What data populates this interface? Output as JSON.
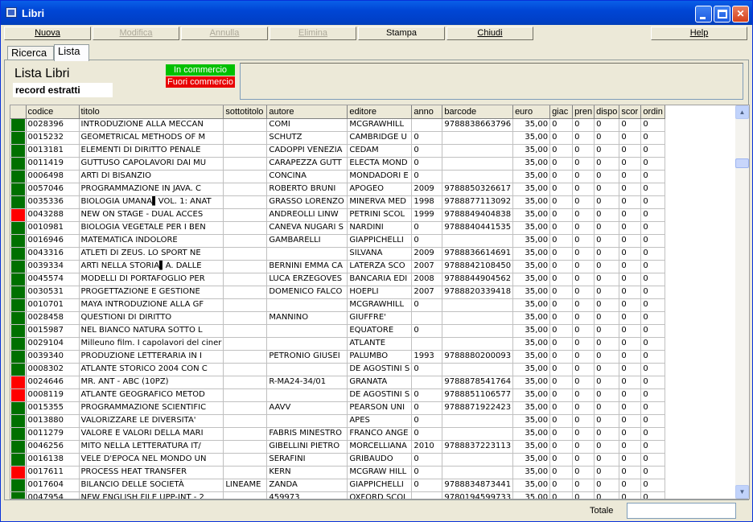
{
  "window": {
    "title": "Libri"
  },
  "toolbar": {
    "buttons": [
      {
        "label": "Nuova",
        "accesskey": "N",
        "enabled": true
      },
      {
        "label": "Modifica",
        "enabled": false
      },
      {
        "label": "Annulla",
        "enabled": false
      },
      {
        "label": "Elimina",
        "enabled": false
      },
      {
        "label": "Stampa",
        "enabled": true
      },
      {
        "label": "Chiudi",
        "enabled": true
      },
      {
        "label": "Help",
        "enabled": true
      }
    ]
  },
  "tabs": [
    {
      "label": "Ricerca",
      "active": false
    },
    {
      "label": "Lista",
      "active": true
    }
  ],
  "panel": {
    "heading": "Lista Libri",
    "sublabel": "record estratti",
    "legend": {
      "green": "In commercio",
      "red": "Fuori commercio"
    }
  },
  "status_colors": {
    "green": "#007000",
    "red": "#ff0000"
  },
  "grid": {
    "columns": [
      "codice",
      "titolo",
      "sottotitolo",
      "autore",
      "editore",
      "anno",
      "barcode",
      "euro",
      "giac",
      "pren",
      "dispo",
      "scor",
      "ordin"
    ],
    "rows": [
      {
        "status": "green",
        "codice": "0028396",
        "titolo": "INTRODUZIONE ALLA MECCAN",
        "sottotitolo": "",
        "autore": "COMI",
        "editore": "MCGRAWHILL",
        "anno": "",
        "barcode": "9788838663796",
        "euro": "35,00",
        "giac": "0",
        "pren": "0",
        "dispo": "0",
        "scor": "0",
        "ordin": "0"
      },
      {
        "status": "green",
        "codice": "0015232",
        "titolo": "GEOMETRICAL METHODS OF M",
        "sottotitolo": "",
        "autore": "SCHUTZ",
        "editore": "CAMBRIDGE U",
        "anno": "0",
        "barcode": "",
        "euro": "35,00",
        "giac": "0",
        "pren": "0",
        "dispo": "0",
        "scor": "0",
        "ordin": "0"
      },
      {
        "status": "green",
        "codice": "0013181",
        "titolo": "ELEMENTI DI DIRITTO PENALE",
        "sottotitolo": "",
        "autore": "CADOPPI VENEZIA",
        "editore": "CEDAM",
        "anno": "0",
        "barcode": "",
        "euro": "35,00",
        "giac": "0",
        "pren": "0",
        "dispo": "0",
        "scor": "0",
        "ordin": "0"
      },
      {
        "status": "green",
        "codice": "0011419",
        "titolo": "GUTTUSO CAPOLAVORI DAI MU",
        "sottotitolo": "",
        "autore": "CARAPEZZA GUTT",
        "editore": "ELECTA MOND",
        "anno": "0",
        "barcode": "",
        "euro": "35,00",
        "giac": "0",
        "pren": "0",
        "dispo": "0",
        "scor": "0",
        "ordin": "0"
      },
      {
        "status": "green",
        "codice": "0006498",
        "titolo": "ARTI DI BISANZIO",
        "sottotitolo": "",
        "autore": "CONCINA",
        "editore": "MONDADORI E",
        "anno": "0",
        "barcode": "",
        "euro": "35,00",
        "giac": "0",
        "pren": "0",
        "dispo": "0",
        "scor": "0",
        "ordin": "0"
      },
      {
        "status": "green",
        "codice": "0057046",
        "titolo": "PROGRAMMAZIONE IN JAVA. C",
        "sottotitolo": "",
        "autore": "ROBERTO BRUNI",
        "editore": "APOGEO",
        "anno": "2009",
        "barcode": "9788850326617",
        "euro": "35,00",
        "giac": "0",
        "pren": "0",
        "dispo": "0",
        "scor": "0",
        "ordin": "0"
      },
      {
        "status": "green",
        "codice": "0035336",
        "titolo": "BIOLOGIA UMANA▌VOL. 1: ANAT",
        "sottotitolo": "",
        "autore": "GRASSO LORENZO",
        "editore": "MINERVA MED",
        "anno": "1998",
        "barcode": "9788877113092",
        "euro": "35,00",
        "giac": "0",
        "pren": "0",
        "dispo": "0",
        "scor": "0",
        "ordin": "0"
      },
      {
        "status": "red",
        "codice": "0043288",
        "titolo": "NEW ON STAGE - DUAL ACCES",
        "sottotitolo": "",
        "autore": "ANDREOLLI LINW",
        "editore": "PETRINI SCOL",
        "anno": "1999",
        "barcode": "9788849404838",
        "euro": "35,00",
        "giac": "0",
        "pren": "0",
        "dispo": "0",
        "scor": "0",
        "ordin": "0"
      },
      {
        "status": "green",
        "codice": "0010981",
        "titolo": "BIOLOGIA VEGETALE PER I BEN",
        "sottotitolo": "",
        "autore": "CANEVA NUGARI S",
        "editore": "NARDINI",
        "anno": "0",
        "barcode": "9788840441535",
        "euro": "35,00",
        "giac": "0",
        "pren": "0",
        "dispo": "0",
        "scor": "0",
        "ordin": "0"
      },
      {
        "status": "green",
        "codice": "0016946",
        "titolo": "MATEMATICA INDOLORE",
        "sottotitolo": "",
        "autore": "GAMBARELLI",
        "editore": "GIAPPICHELLI",
        "anno": "0",
        "barcode": "",
        "euro": "35,00",
        "giac": "0",
        "pren": "0",
        "dispo": "0",
        "scor": "0",
        "ordin": "0"
      },
      {
        "status": "green",
        "codice": "0043316",
        "titolo": "ATLETI DI ZEUS. LO SPORT NE",
        "sottotitolo": "",
        "autore": "",
        "editore": "SILVANA",
        "anno": "2009",
        "barcode": "9788836614691",
        "euro": "35,00",
        "giac": "0",
        "pren": "0",
        "dispo": "0",
        "scor": "0",
        "ordin": "0"
      },
      {
        "status": "green",
        "codice": "0039334",
        "titolo": "ARTI NELLA STORIA▌A. DALLE",
        "sottotitolo": "",
        "autore": "BERNINI EMMA CA",
        "editore": "LATERZA SCO",
        "anno": "2007",
        "barcode": "9788842108450",
        "euro": "35,00",
        "giac": "0",
        "pren": "0",
        "dispo": "0",
        "scor": "0",
        "ordin": "0"
      },
      {
        "status": "green",
        "codice": "0045574",
        "titolo": "MODELLI DI PORTAFOGLIO PER",
        "sottotitolo": "",
        "autore": "LUCA ERZEGOVES",
        "editore": "BANCARIA EDI",
        "anno": "2008",
        "barcode": "9788844904562",
        "euro": "35,00",
        "giac": "0",
        "pren": "0",
        "dispo": "0",
        "scor": "0",
        "ordin": "0"
      },
      {
        "status": "green",
        "codice": "0030531",
        "titolo": "PROGETTAZIONE E GESTIONE",
        "sottotitolo": "",
        "autore": "DOMENICO FALCO",
        "editore": "HOEPLI",
        "anno": "2007",
        "barcode": "9788820339418",
        "euro": "35,00",
        "giac": "0",
        "pren": "0",
        "dispo": "0",
        "scor": "0",
        "ordin": "0"
      },
      {
        "status": "green",
        "codice": "0010701",
        "titolo": "MAYA INTRODUZIONE ALLA GF",
        "sottotitolo": "",
        "autore": "",
        "editore": "MCGRAWHILL",
        "anno": "0",
        "barcode": "",
        "euro": "35,00",
        "giac": "0",
        "pren": "0",
        "dispo": "0",
        "scor": "0",
        "ordin": "0"
      },
      {
        "status": "green",
        "codice": "0028458",
        "titolo": "QUESTIONI DI DIRITTO",
        "sottotitolo": "",
        "autore": "MANNINO",
        "editore": "GIUFFRE'",
        "anno": "",
        "barcode": "",
        "euro": "35,00",
        "giac": "0",
        "pren": "0",
        "dispo": "0",
        "scor": "0",
        "ordin": "0"
      },
      {
        "status": "green",
        "codice": "0015987",
        "titolo": "NEL BIANCO NATURA SOTTO L",
        "sottotitolo": "",
        "autore": "",
        "editore": "EQUATORE",
        "anno": "0",
        "barcode": "",
        "euro": "35,00",
        "giac": "0",
        "pren": "0",
        "dispo": "0",
        "scor": "0",
        "ordin": "0"
      },
      {
        "status": "green",
        "codice": "0029104",
        "titolo": "Milleuno film. I capolavori del ciner",
        "sottotitolo": "",
        "autore": "",
        "editore": "ATLANTE",
        "anno": "",
        "barcode": "",
        "euro": "35,00",
        "giac": "0",
        "pren": "0",
        "dispo": "0",
        "scor": "0",
        "ordin": "0"
      },
      {
        "status": "green",
        "codice": "0039340",
        "titolo": "PRODUZIONE LETTERARIA IN I",
        "sottotitolo": "",
        "autore": "PETRONIO GIUSEI",
        "editore": "PALUMBO",
        "anno": "1993",
        "barcode": "9788880200093",
        "euro": "35,00",
        "giac": "0",
        "pren": "0",
        "dispo": "0",
        "scor": "0",
        "ordin": "0"
      },
      {
        "status": "green",
        "codice": "0008302",
        "titolo": "ATLANTE STORICO 2004 CON C",
        "sottotitolo": "",
        "autore": "",
        "editore": "DE AGOSTINI S",
        "anno": "0",
        "barcode": "",
        "euro": "35,00",
        "giac": "0",
        "pren": "0",
        "dispo": "0",
        "scor": "0",
        "ordin": "0"
      },
      {
        "status": "red",
        "codice": "0024646",
        "titolo": "MR. ANT - ABC (10PZ)",
        "sottotitolo": "",
        "autore": "R-MA24-34/01",
        "editore": "GRANATA",
        "anno": "",
        "barcode": "9788878541764",
        "euro": "35,00",
        "giac": "0",
        "pren": "0",
        "dispo": "0",
        "scor": "0",
        "ordin": "0"
      },
      {
        "status": "red",
        "codice": "0008119",
        "titolo": "ATLANTE GEOGRAFICO METOD",
        "sottotitolo": "",
        "autore": "",
        "editore": "DE AGOSTINI S",
        "anno": "0",
        "barcode": "9788851106577",
        "euro": "35,00",
        "giac": "0",
        "pren": "0",
        "dispo": "0",
        "scor": "0",
        "ordin": "0"
      },
      {
        "status": "green",
        "codice": "0015355",
        "titolo": "PROGRAMMAZIONE SCIENTIFIC",
        "sottotitolo": "",
        "autore": "AAVV",
        "editore": "PEARSON UNI",
        "anno": "0",
        "barcode": "9788871922423",
        "euro": "35,00",
        "giac": "0",
        "pren": "0",
        "dispo": "0",
        "scor": "0",
        "ordin": "0"
      },
      {
        "status": "green",
        "codice": "0013880",
        "titolo": "VALORIZZARE LE DIVERSITA'",
        "sottotitolo": "",
        "autore": "",
        "editore": "APES",
        "anno": "0",
        "barcode": "",
        "euro": "35,00",
        "giac": "0",
        "pren": "0",
        "dispo": "0",
        "scor": "0",
        "ordin": "0"
      },
      {
        "status": "green",
        "codice": "0011279",
        "titolo": "VALORE E VALORI DELLA MARI",
        "sottotitolo": "",
        "autore": "FABRIS MINESTRO",
        "editore": "FRANCO ANGE",
        "anno": "0",
        "barcode": "",
        "euro": "35,00",
        "giac": "0",
        "pren": "0",
        "dispo": "0",
        "scor": "0",
        "ordin": "0"
      },
      {
        "status": "green",
        "codice": "0046256",
        "titolo": "MITO NELLA LETTERATURA IT/",
        "sottotitolo": "",
        "autore": "GIBELLINI PIETRO",
        "editore": "MORCELLIANA",
        "anno": "2010",
        "barcode": "9788837223113",
        "euro": "35,00",
        "giac": "0",
        "pren": "0",
        "dispo": "0",
        "scor": "0",
        "ordin": "0"
      },
      {
        "status": "green",
        "codice": "0016138",
        "titolo": "VELE D'EPOCA NEL MONDO UN",
        "sottotitolo": "",
        "autore": "SERAFINI",
        "editore": "GRIBAUDO",
        "anno": "0",
        "barcode": "",
        "euro": "35,00",
        "giac": "0",
        "pren": "0",
        "dispo": "0",
        "scor": "0",
        "ordin": "0"
      },
      {
        "status": "red",
        "codice": "0017611",
        "titolo": "PROCESS HEAT TRANSFER",
        "sottotitolo": "",
        "autore": "KERN",
        "editore": "MCGRAW HILL",
        "anno": "0",
        "barcode": "",
        "euro": "35,00",
        "giac": "0",
        "pren": "0",
        "dispo": "0",
        "scor": "0",
        "ordin": "0"
      },
      {
        "status": "green",
        "codice": "0017604",
        "titolo": "BILANCIO DELLE SOCIETÀ",
        "sottotitolo": "LINEAME",
        "autore": "ZANDA",
        "editore": "GIAPPICHELLI",
        "anno": "0",
        "barcode": "9788834873441",
        "euro": "35,00",
        "giac": "0",
        "pren": "0",
        "dispo": "0",
        "scor": "0",
        "ordin": "0"
      },
      {
        "status": "green",
        "codice": "0047954",
        "titolo": "NEW ENGLISH FILE UPP-INT - 2",
        "sottotitolo": "",
        "autore": "459973",
        "editore": "OXFORD SCOL",
        "anno": "",
        "barcode": "9780194599733",
        "euro": "35,00",
        "giac": "0",
        "pren": "0",
        "dispo": "0",
        "scor": "0",
        "ordin": "0"
      }
    ]
  },
  "status": {
    "total_label": "Totale",
    "total_value": ""
  }
}
